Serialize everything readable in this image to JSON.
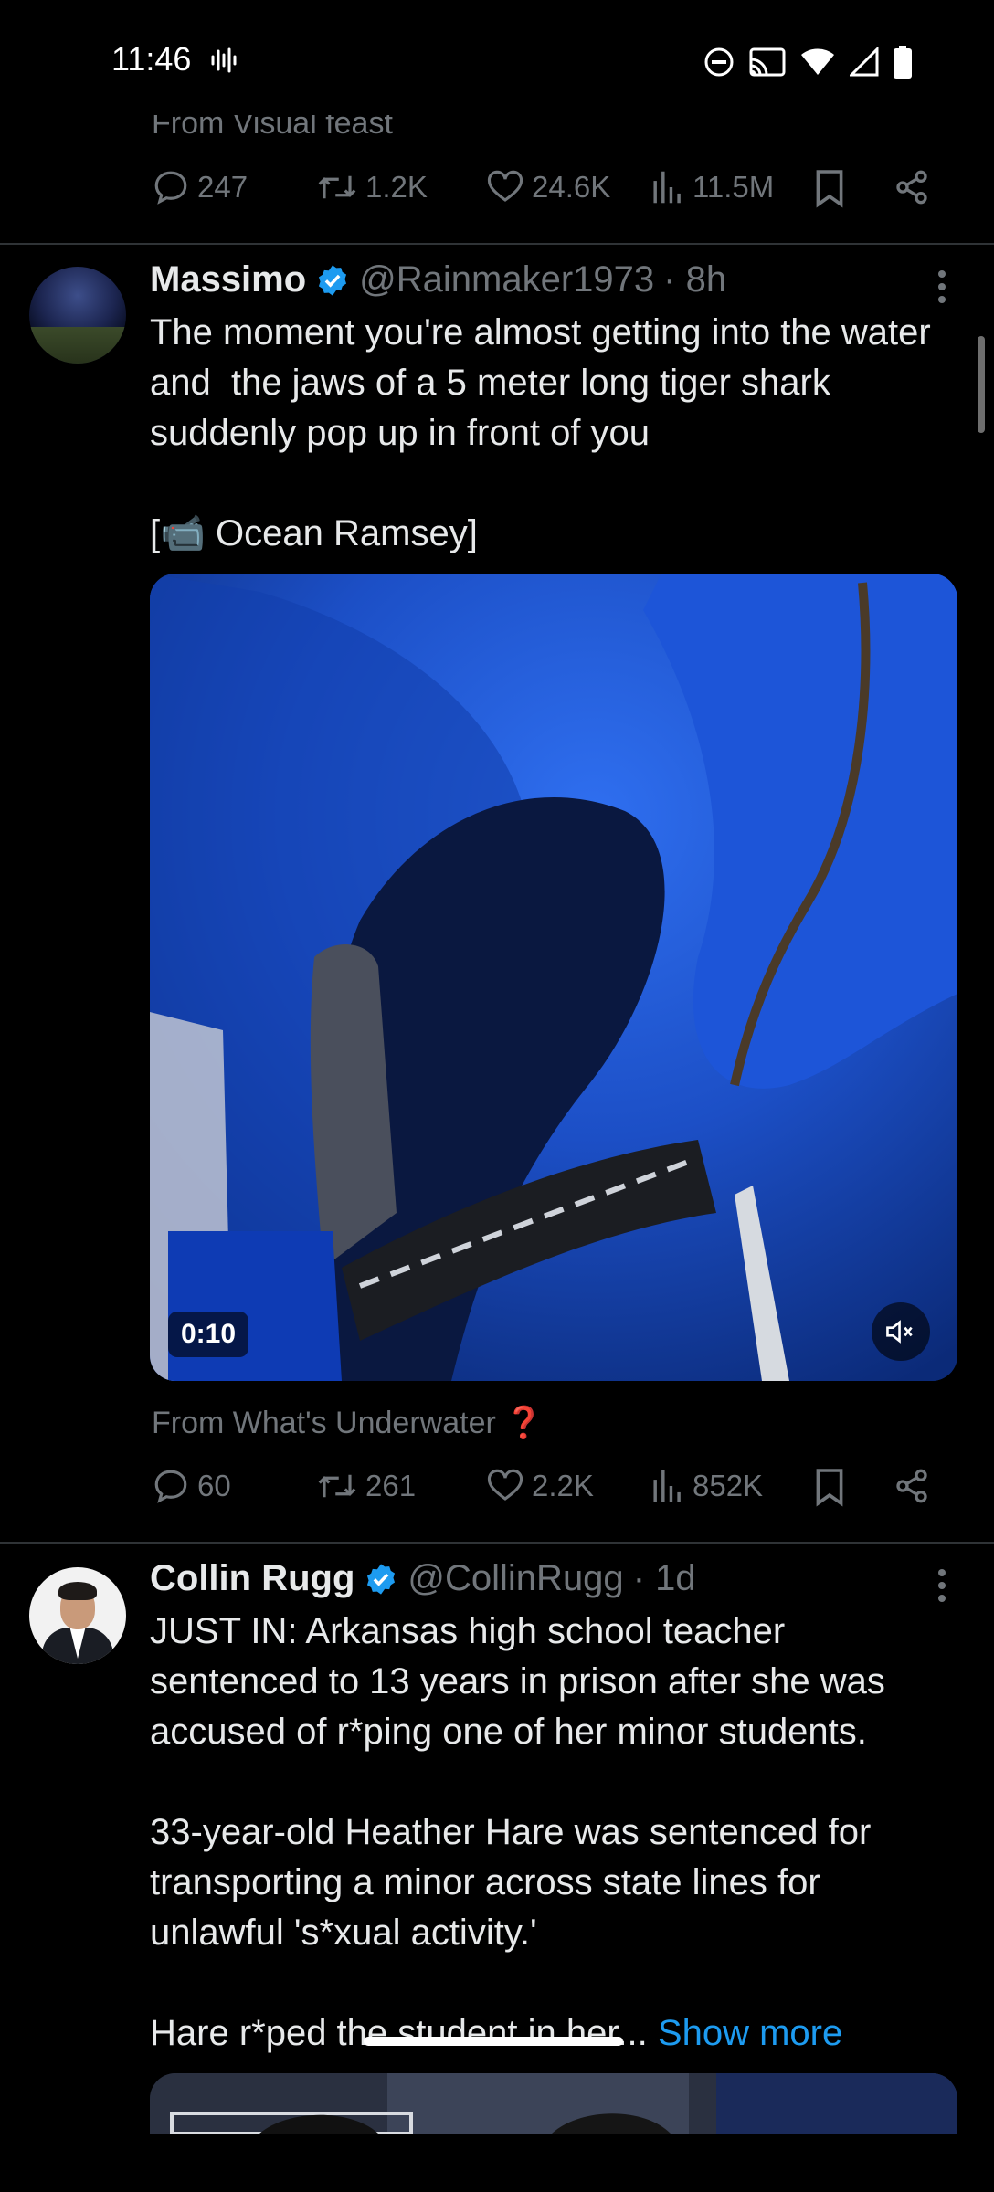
{
  "status_bar": {
    "time": "11:46",
    "icons": [
      "sound-wave-icon",
      "do-not-disturb-icon",
      "cast-icon",
      "wifi-icon",
      "cell-signal-icon",
      "battery-icon"
    ]
  },
  "colors": {
    "background": "#000000",
    "text_primary": "#e7e9ea",
    "text_secondary": "#71767b",
    "accent": "#1d9bf0",
    "divider": "#2f3336"
  },
  "previous_tweet": {
    "from_label": "From Visual feast",
    "actions": {
      "replies": "247",
      "reposts": "1.2K",
      "likes": "24.6K",
      "views": "11.5M"
    }
  },
  "tweets": [
    {
      "name": "Massimo",
      "handle": "@Rainmaker1973",
      "time": "· 8h",
      "text": "The moment you're almost getting into the water and  the jaws of a 5 meter long tiger shark suddenly pop up in front of you\n\n[📹 Ocean Ramsey]",
      "media": {
        "type": "video",
        "duration": "0:10",
        "mute_icon": "speaker-muted-icon"
      },
      "from_label": "From What's Underwater ❓",
      "actions": {
        "replies": "60",
        "reposts": "261",
        "likes": "2.2K",
        "views": "852K"
      }
    },
    {
      "name": "Collin Rugg",
      "handle": "@CollinRugg",
      "time": "· 1d",
      "text": "JUST IN: Arkansas high school teacher sentenced to 13 years in prison after she was accused of r*ping one of her minor students.\n\n33-year-old Heather Hare was sentenced for transporting a minor across state lines for unlawful 's*xual activity.'\n\nHare r*ped the student in her... ",
      "show_more": "Show more"
    }
  ]
}
